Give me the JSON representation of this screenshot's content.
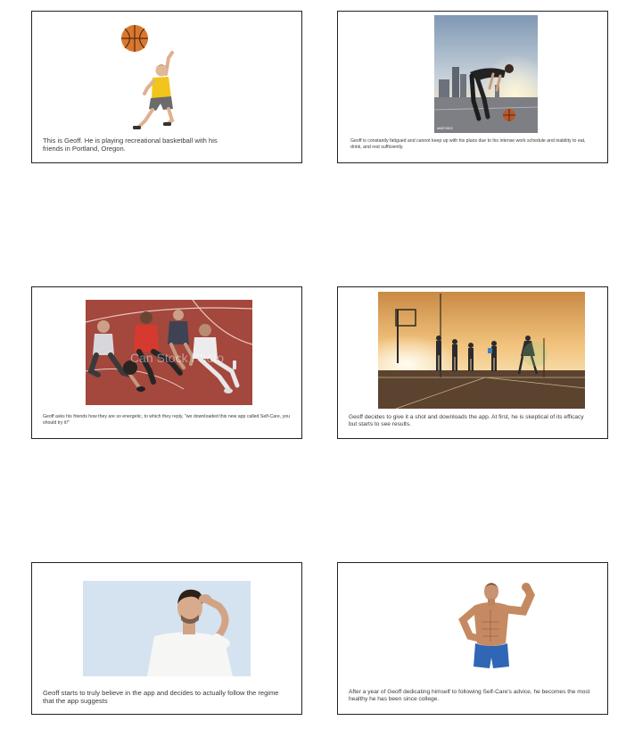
{
  "slides": [
    {
      "caption": "This is Geoff. He is playing recreational basketball with his friends in Portland, Oregon.",
      "image": "man-jumping-with-basketball"
    },
    {
      "caption": "Geoff is constantly fatigued and cannot keep up with his plans due to his intense work schedule and inability to eat, drink, and rest sufficiently.",
      "image": "tired-man-on-court-at-sunset",
      "watermark": "#6871502"
    },
    {
      "caption": "Geoff asks his friends how they are so energetic, to which they reply, \"we downloaded this new app called Self-Care, you should try it!\"",
      "image": "friends-resting-on-court",
      "watermark": "Can Stock Photo"
    },
    {
      "caption": "Geoff decides to give it a shot and downloads the app. At first, he is skeptical of its efficacy but starts to see results.",
      "image": "silhouette-basketball-game-at-sunset"
    },
    {
      "caption": "Geoff starts to truly believe in the app and decides to actually follow the regime that the app suggests",
      "image": "thinking-man-scratching-head"
    },
    {
      "caption": "After a year of Geoff dedicating himself to following Self-Care's advice, he becomes the most healthy he has been since college.",
      "image": "muscular-man-flexing"
    }
  ],
  "colors": {
    "border": "#222222",
    "caption_text": "#3a3a3a",
    "ball": "#d8782e",
    "shirt_yellow": "#f2c51c",
    "court_red": "#a4473d",
    "sky_blue": "#d5e3f1",
    "shorts_blue": "#2f66b5"
  }
}
